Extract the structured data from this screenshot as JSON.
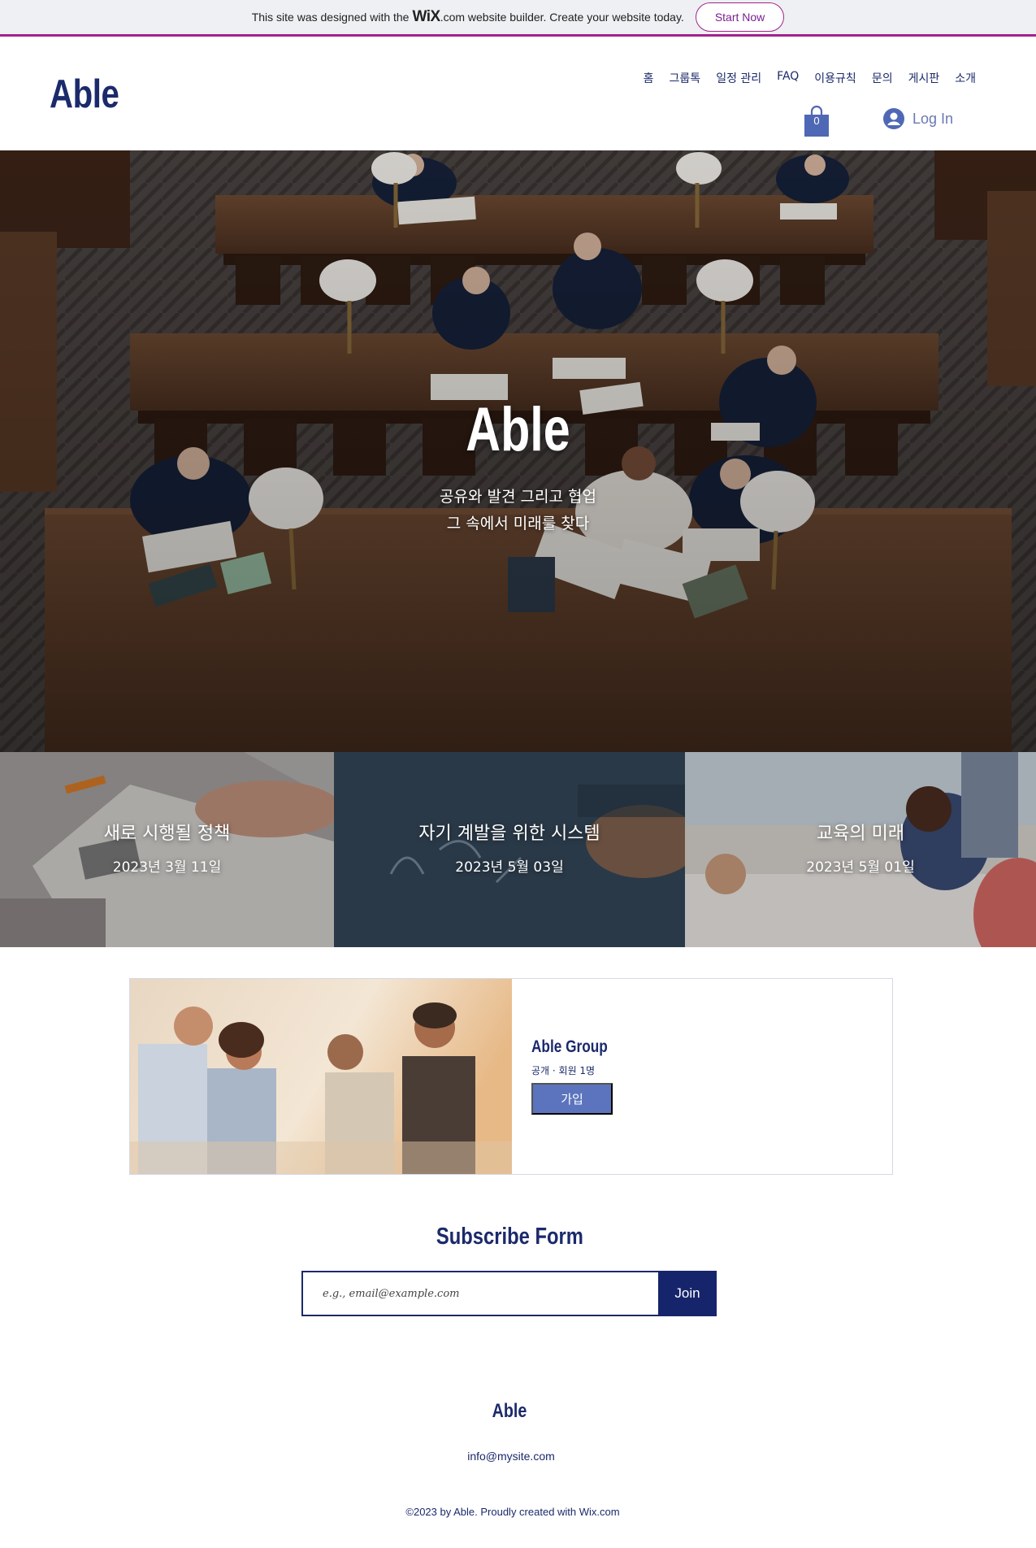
{
  "wix_banner": {
    "text_before": "This site was designed with the",
    "brand": "WiX",
    "text_after": ".com website builder. Create your website today.",
    "cta_label": "Start Now"
  },
  "header": {
    "logo": "Able",
    "nav": [
      "홈",
      "그룹톡",
      "일정 관리",
      "FAQ",
      "이용규칙",
      "문의",
      "게시판",
      "소개"
    ],
    "cart_count": "0",
    "login_label": "Log In"
  },
  "hero": {
    "title": "Able",
    "subtitle_line1": "공유와 발견 그리고 협업",
    "subtitle_line2": "그 속에서 미래를 찾다"
  },
  "posts": [
    {
      "title": "새로 시행될 정책",
      "date": "2023년 3월 11일"
    },
    {
      "title": "자기 계발을 위한 시스템",
      "date": "2023년 5월 03일"
    },
    {
      "title": "교육의 미래",
      "date": "2023년 5월 01일"
    }
  ],
  "group": {
    "name": "Able Group",
    "meta": "공개 · 회원 1명",
    "join_label": "가입"
  },
  "subscribe": {
    "title": "Subscribe Form",
    "placeholder": "e.g., email@example.com",
    "button_label": "Join"
  },
  "footer": {
    "logo": "Able",
    "email": "info@mysite.com",
    "copyright": "©2023 by Able. Proudly created with Wix.com"
  },
  "colors": {
    "brand_navy": "#1b2a6b",
    "wix_purple": "#a3228a",
    "join_blue": "#5b74bd"
  },
  "icons": {
    "cart": "shopping-bag-icon",
    "login": "user-avatar-icon"
  }
}
